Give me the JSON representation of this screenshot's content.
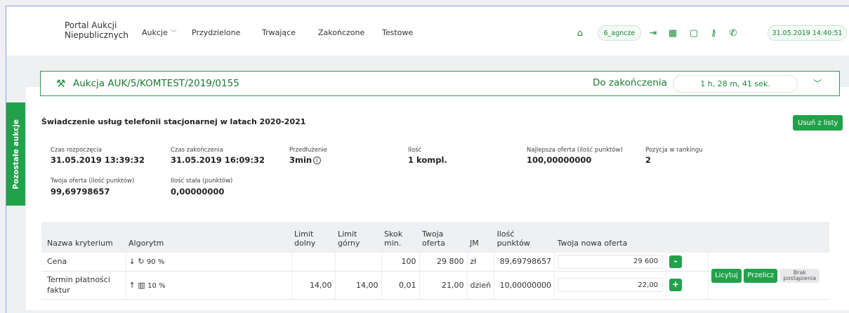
{
  "nav": {
    "brand_line1": "Portal Aukcji",
    "brand_line2": "Niepublicznych",
    "items": [
      "Aukcje",
      "Przydzielone",
      "Trwające",
      "Zakończone",
      "Testowe"
    ],
    "user": "6_agncze",
    "datetime": "31.05.2019 14:40:51",
    "icons": [
      "home-icon",
      "logout-icon",
      "building-icon",
      "book-icon",
      "key-icon",
      "phone-icon"
    ]
  },
  "auction": {
    "title": "Aukcja AUK/5/KOMTEST/2019/0155",
    "end_label": "Do zakończenia",
    "timer": "1 h, 28 m, 41 sek."
  },
  "side_tab": "Pozostałe aukcje",
  "card": {
    "title": "Świadczenie usług telefonii stacjonarnej w latach 2020-2021",
    "remove_button": "Usuń z listy",
    "info": {
      "start_label": "Czas rozpoczęcia",
      "start_value": "31.05.2019 13:39:32",
      "end_label": "Czas zakończenia",
      "end_value": "31.05.2019 16:09:32",
      "extension_label": "Przedłużenie",
      "extension_value": "3min",
      "quantity_label": "Ilość",
      "quantity_value": "1 kompl.",
      "best_label": "Najlepsza oferta (ilość punktów)",
      "best_value": "100,00000000",
      "rank_label": "Pozycja w rankingu",
      "rank_value": "2",
      "your_label": "Twoja oferta (ilość punktów)",
      "your_value": "99,69798657",
      "fixed_label": "Ilość stała (punktów)",
      "fixed_value": "0,00000000"
    }
  },
  "table": {
    "headers": {
      "name": "Nazwa kryterium",
      "algo": "Algorytm",
      "limit_low_1": "Limit",
      "limit_low_2": "dolny",
      "limit_high_1": "Limit",
      "limit_high_2": "górny",
      "step_1": "Skok",
      "step_2": "min.",
      "offer_1": "Twoja",
      "offer_2": "oferta",
      "unit": "JM",
      "points_1": "Ilość",
      "points_2": "punktów",
      "new_offer": "Twoja nowa oferta"
    },
    "rows": [
      {
        "name": "Cena",
        "algo_arrow": "↓",
        "algo_icon": "↻",
        "algo_pct": "90 %",
        "limit_low": "",
        "limit_high": "",
        "step": "100",
        "offer": "29 800",
        "unit": "zł",
        "points": "89,69798657",
        "new_offer": "29 600",
        "button": "-"
      },
      {
        "name_1": "Termin płatności",
        "name_2": "faktur",
        "algo_arrow": "↑",
        "algo_icon": "▥",
        "algo_pct": "10 %",
        "limit_low": "14,00",
        "limit_high": "14,00",
        "step": "0,01",
        "offer": "21,00",
        "unit": "dzień",
        "points": "10,00000000",
        "new_offer": "22,00",
        "button": "+"
      }
    ],
    "actions": {
      "bid": "Licytuj",
      "recalc": "Przelicz",
      "no_step_1": "Brak",
      "no_step_2": "postąpienia"
    }
  },
  "colors": {
    "accent": "#22a14b",
    "accent_text": "#1a7a36",
    "offer_red": "#e05560",
    "page_bg": "#eef0f2"
  }
}
